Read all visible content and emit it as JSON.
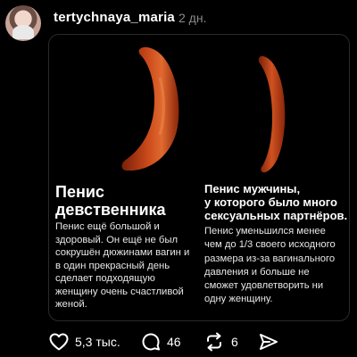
{
  "post": {
    "username": "tertychnaya_maria",
    "time": "2 дн."
  },
  "card": {
    "left": {
      "title_line1": "Пенис",
      "title_line2": "девственника",
      "desc": "Пенис ещё большой и здоровый. Он ещё не был сокрушён дюжинами вагин и в один прекрасный день сделает подходящую женщину очень счастливой женой."
    },
    "right": {
      "title_line1": "Пенис мужчины,",
      "title_line2": "у которого было много",
      "title_line3": "сексуальных партнёров.",
      "desc": "Пенис уменьшился менее чем до 1/3 своего исходного размера из-за вагинального давления и больше не сможет удовлетворить ни одну женщину."
    }
  },
  "actions": {
    "likes": "5,3 тыс.",
    "comments": "46",
    "reposts": "6"
  },
  "colors": {
    "sausage": "#b83a12",
    "sausage_highlight": "#e0662f",
    "muted": "#8a8a8a"
  },
  "icons": [
    "heart-icon",
    "comment-icon",
    "repost-icon",
    "share-icon"
  ]
}
